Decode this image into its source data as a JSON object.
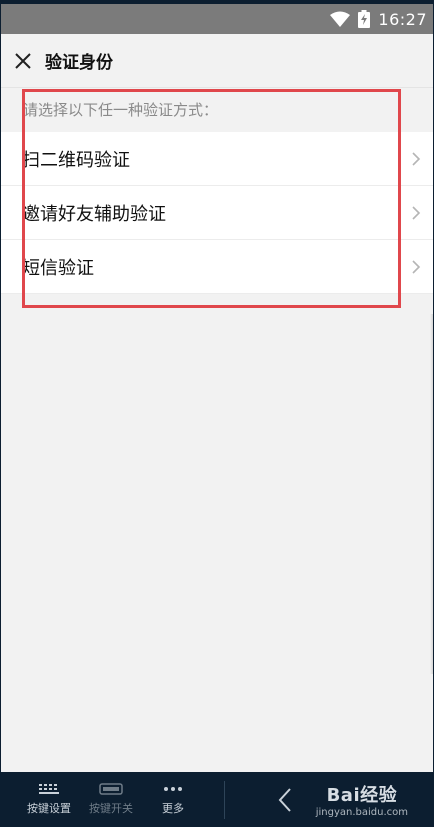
{
  "status_bar": {
    "time": "16:27",
    "icons": [
      "wifi-icon",
      "battery-charging-icon"
    ]
  },
  "header": {
    "title": "验证身份",
    "close_icon": "close-icon"
  },
  "main": {
    "hint": "请选择以下任一种验证方式：",
    "options": [
      {
        "label": "扫二维码验证"
      },
      {
        "label": "邀请好友辅助验证"
      },
      {
        "label": "短信验证"
      }
    ]
  },
  "colors": {
    "highlight": "#e0474c",
    "status_bar": "#7b7b7b",
    "background": "#f2f2f2"
  },
  "bottom_toolbar": {
    "items": [
      {
        "label": "按键设置",
        "icon": "keyboard-icon"
      },
      {
        "label": "按键开关",
        "icon": "toggle-icon"
      },
      {
        "label": "更多",
        "icon": "more-icon"
      }
    ],
    "back_icon": "back-arrow-icon",
    "watermark_main": "Bai经验",
    "watermark_sub": "jingyan.baidu.com"
  }
}
